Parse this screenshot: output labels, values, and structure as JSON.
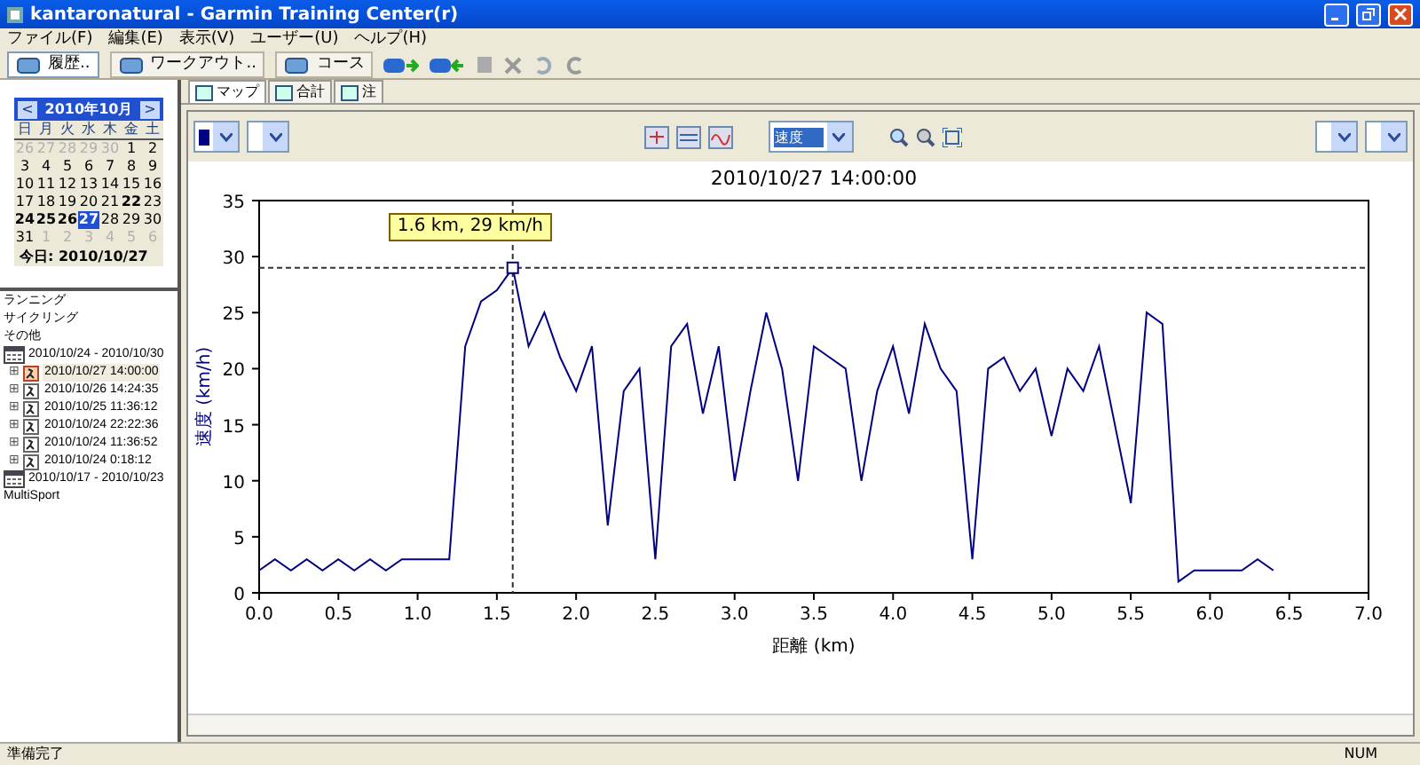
{
  "window": {
    "title": "kantaronatural - Garmin Training Center(r)"
  },
  "menu": [
    "ファイル(F)",
    "編集(E)",
    "表示(V)",
    "ユーザー(U)",
    "ヘルプ(H)"
  ],
  "toolbar": [
    {
      "label": "履歴..",
      "selected": true
    },
    {
      "label": "ワークアウト..",
      "selected": false
    },
    {
      "label": "コース",
      "selected": false
    }
  ],
  "calendar": {
    "title": "2010年10月",
    "prev": "<",
    "next": ">",
    "weekdays": [
      "日",
      "月",
      "火",
      "水",
      "木",
      "金",
      "土"
    ],
    "weeks": [
      [
        {
          "day": "26",
          "muted": true,
          "bold": false,
          "selected": false
        },
        {
          "day": "27",
          "muted": true,
          "bold": false,
          "selected": false
        },
        {
          "day": "28",
          "muted": true,
          "bold": false,
          "selected": false
        },
        {
          "day": "29",
          "muted": true,
          "bold": false,
          "selected": false
        },
        {
          "day": "30",
          "muted": true,
          "bold": false,
          "selected": false
        },
        {
          "day": "1",
          "muted": false,
          "bold": false,
          "selected": false
        },
        {
          "day": "2",
          "muted": false,
          "bold": false,
          "selected": false
        }
      ],
      [
        {
          "day": "3",
          "muted": false,
          "bold": false,
          "selected": false
        },
        {
          "day": "4",
          "muted": false,
          "bold": false,
          "selected": false
        },
        {
          "day": "5",
          "muted": false,
          "bold": false,
          "selected": false
        },
        {
          "day": "6",
          "muted": false,
          "bold": false,
          "selected": false
        },
        {
          "day": "7",
          "muted": false,
          "bold": false,
          "selected": false
        },
        {
          "day": "8",
          "muted": false,
          "bold": false,
          "selected": false
        },
        {
          "day": "9",
          "muted": false,
          "bold": false,
          "selected": false
        }
      ],
      [
        {
          "day": "10",
          "muted": false,
          "bold": false,
          "selected": false
        },
        {
          "day": "11",
          "muted": false,
          "bold": false,
          "selected": false
        },
        {
          "day": "12",
          "muted": false,
          "bold": false,
          "selected": false
        },
        {
          "day": "13",
          "muted": false,
          "bold": false,
          "selected": false
        },
        {
          "day": "14",
          "muted": false,
          "bold": false,
          "selected": false
        },
        {
          "day": "15",
          "muted": false,
          "bold": false,
          "selected": false
        },
        {
          "day": "16",
          "muted": false,
          "bold": false,
          "selected": false
        }
      ],
      [
        {
          "day": "17",
          "muted": false,
          "bold": false,
          "selected": false
        },
        {
          "day": "18",
          "muted": false,
          "bold": false,
          "selected": false
        },
        {
          "day": "19",
          "muted": false,
          "bold": false,
          "selected": false
        },
        {
          "day": "20",
          "muted": false,
          "bold": false,
          "selected": false
        },
        {
          "day": "21",
          "muted": false,
          "bold": false,
          "selected": false
        },
        {
          "day": "22",
          "muted": false,
          "bold": true,
          "selected": false
        },
        {
          "day": "23",
          "muted": false,
          "bold": false,
          "selected": false
        }
      ],
      [
        {
          "day": "24",
          "muted": false,
          "bold": true,
          "selected": false
        },
        {
          "day": "25",
          "muted": false,
          "bold": true,
          "selected": false
        },
        {
          "day": "26",
          "muted": false,
          "bold": true,
          "selected": false
        },
        {
          "day": "27",
          "muted": false,
          "bold": true,
          "selected": true
        },
        {
          "day": "28",
          "muted": false,
          "bold": false,
          "selected": false
        },
        {
          "day": "29",
          "muted": false,
          "bold": false,
          "selected": false
        },
        {
          "day": "30",
          "muted": false,
          "bold": false,
          "selected": false
        }
      ],
      [
        {
          "day": "31",
          "muted": false,
          "bold": false,
          "selected": false
        },
        {
          "day": "1",
          "muted": true,
          "bold": false,
          "selected": false
        },
        {
          "day": "2",
          "muted": true,
          "bold": false,
          "selected": false
        },
        {
          "day": "3",
          "muted": true,
          "bold": false,
          "selected": false
        },
        {
          "day": "4",
          "muted": true,
          "bold": false,
          "selected": false
        },
        {
          "day": "5",
          "muted": true,
          "bold": false,
          "selected": false
        },
        {
          "day": "6",
          "muted": true,
          "bold": false,
          "selected": false
        }
      ]
    ],
    "today": "今日: 2010/10/27"
  },
  "tree": [
    {
      "label": "ランニング",
      "kind": "category"
    },
    {
      "label": "サイクリング",
      "kind": "category"
    },
    {
      "label": "その他",
      "kind": "category"
    },
    {
      "label": "2010/10/24 - 2010/10/30",
      "kind": "week",
      "children": [
        {
          "label": "2010/10/27 14:00:00",
          "selected": true,
          "expander": "⊞"
        },
        {
          "label": "2010/10/26 14:24:35",
          "selected": false,
          "expander": "⊞"
        },
        {
          "label": "2010/10/25 11:36:12",
          "selected": false,
          "expander": "⊞"
        },
        {
          "label": "2010/10/24 22:22:36",
          "selected": false,
          "expander": "⊞"
        },
        {
          "label": "2010/10/24 11:36:52",
          "selected": false,
          "expander": "⊞"
        },
        {
          "label": "2010/10/24 0:18:12",
          "selected": false,
          "expander": "⊞"
        }
      ]
    },
    {
      "label": "2010/10/17 - 2010/10/23",
      "kind": "week"
    },
    {
      "label": "MultiSport",
      "kind": "category"
    }
  ],
  "tabs": [
    {
      "label": "マップ",
      "selected": true
    },
    {
      "label": "合計",
      "selected": false
    },
    {
      "label": "注",
      "selected": false
    }
  ],
  "chart_toolbar": {
    "metric": "速度"
  },
  "chart": {
    "chart_data": {
      "type": "line",
      "title": "2010/10/27 14:00:00",
      "xlabel": "距離 (km)",
      "ylabel": "速度 (km/h)",
      "x": [
        0.0,
        0.1,
        0.2,
        0.3,
        0.4,
        0.5,
        0.6,
        0.7,
        0.8,
        0.9,
        1.0,
        1.1,
        1.2,
        1.3,
        1.4,
        1.5,
        1.6,
        1.7,
        1.8,
        1.9,
        2.0,
        2.1,
        2.2,
        2.3,
        2.4,
        2.5,
        2.6,
        2.7,
        2.8,
        2.9,
        3.0,
        3.1,
        3.2,
        3.3,
        3.4,
        3.5,
        3.6,
        3.7,
        3.8,
        3.9,
        4.0,
        4.1,
        4.2,
        4.3,
        4.4,
        4.5,
        4.6,
        4.7,
        4.8,
        4.9,
        5.0,
        5.1,
        5.2,
        5.3,
        5.4,
        5.5,
        5.6,
        5.7,
        5.8,
        5.9,
        6.0,
        6.1,
        6.2,
        6.3,
        6.4
      ],
      "series": [
        {
          "color": "#000080",
          "values": [
            2,
            3,
            2,
            3,
            2,
            3,
            2,
            3,
            2,
            3,
            3,
            3,
            3,
            22,
            26,
            27,
            29,
            22,
            25,
            21,
            18,
            22,
            6,
            18,
            20,
            3,
            22,
            24,
            16,
            22,
            10,
            18,
            25,
            20,
            10,
            22,
            21,
            20,
            10,
            18,
            22,
            16,
            24,
            20,
            18,
            3,
            20,
            21,
            18,
            20,
            14,
            20,
            18,
            22,
            15,
            8,
            25,
            24,
            1,
            2,
            2,
            2,
            2,
            3,
            2
          ]
        }
      ],
      "xlim": [
        0,
        7
      ],
      "ylim": [
        0,
        35
      ],
      "xticks": [
        {
          "value": 0,
          "label": "0.0"
        },
        {
          "value": 0.5,
          "label": "0.5"
        },
        {
          "value": 1,
          "label": "1.0"
        },
        {
          "value": 1.5,
          "label": "1.5"
        },
        {
          "value": 2,
          "label": "2.0"
        },
        {
          "value": 2.5,
          "label": "2.5"
        },
        {
          "value": 3,
          "label": "3.0"
        },
        {
          "value": 3.5,
          "label": "3.5"
        },
        {
          "value": 4,
          "label": "4.0"
        },
        {
          "value": 4.5,
          "label": "4.5"
        },
        {
          "value": 5,
          "label": "5.0"
        },
        {
          "value": 5.5,
          "label": "5.5"
        },
        {
          "value": 6,
          "label": "6.0"
        },
        {
          "value": 6.5,
          "label": "6.5"
        },
        {
          "value": 7,
          "label": "7.0"
        }
      ],
      "yticks": [
        0,
        5,
        10,
        15,
        20,
        25,
        30,
        35
      ],
      "ref_lines": [
        {
          "axis": "y",
          "value": 29
        },
        {
          "axis": "x",
          "value": 1.6
        }
      ],
      "annotations": [
        {
          "x": 1.6,
          "y": 29,
          "text": "1.6 km, 29 km/h"
        }
      ]
    }
  },
  "status_bar": {
    "left": "準備完了",
    "right": "NUM"
  }
}
